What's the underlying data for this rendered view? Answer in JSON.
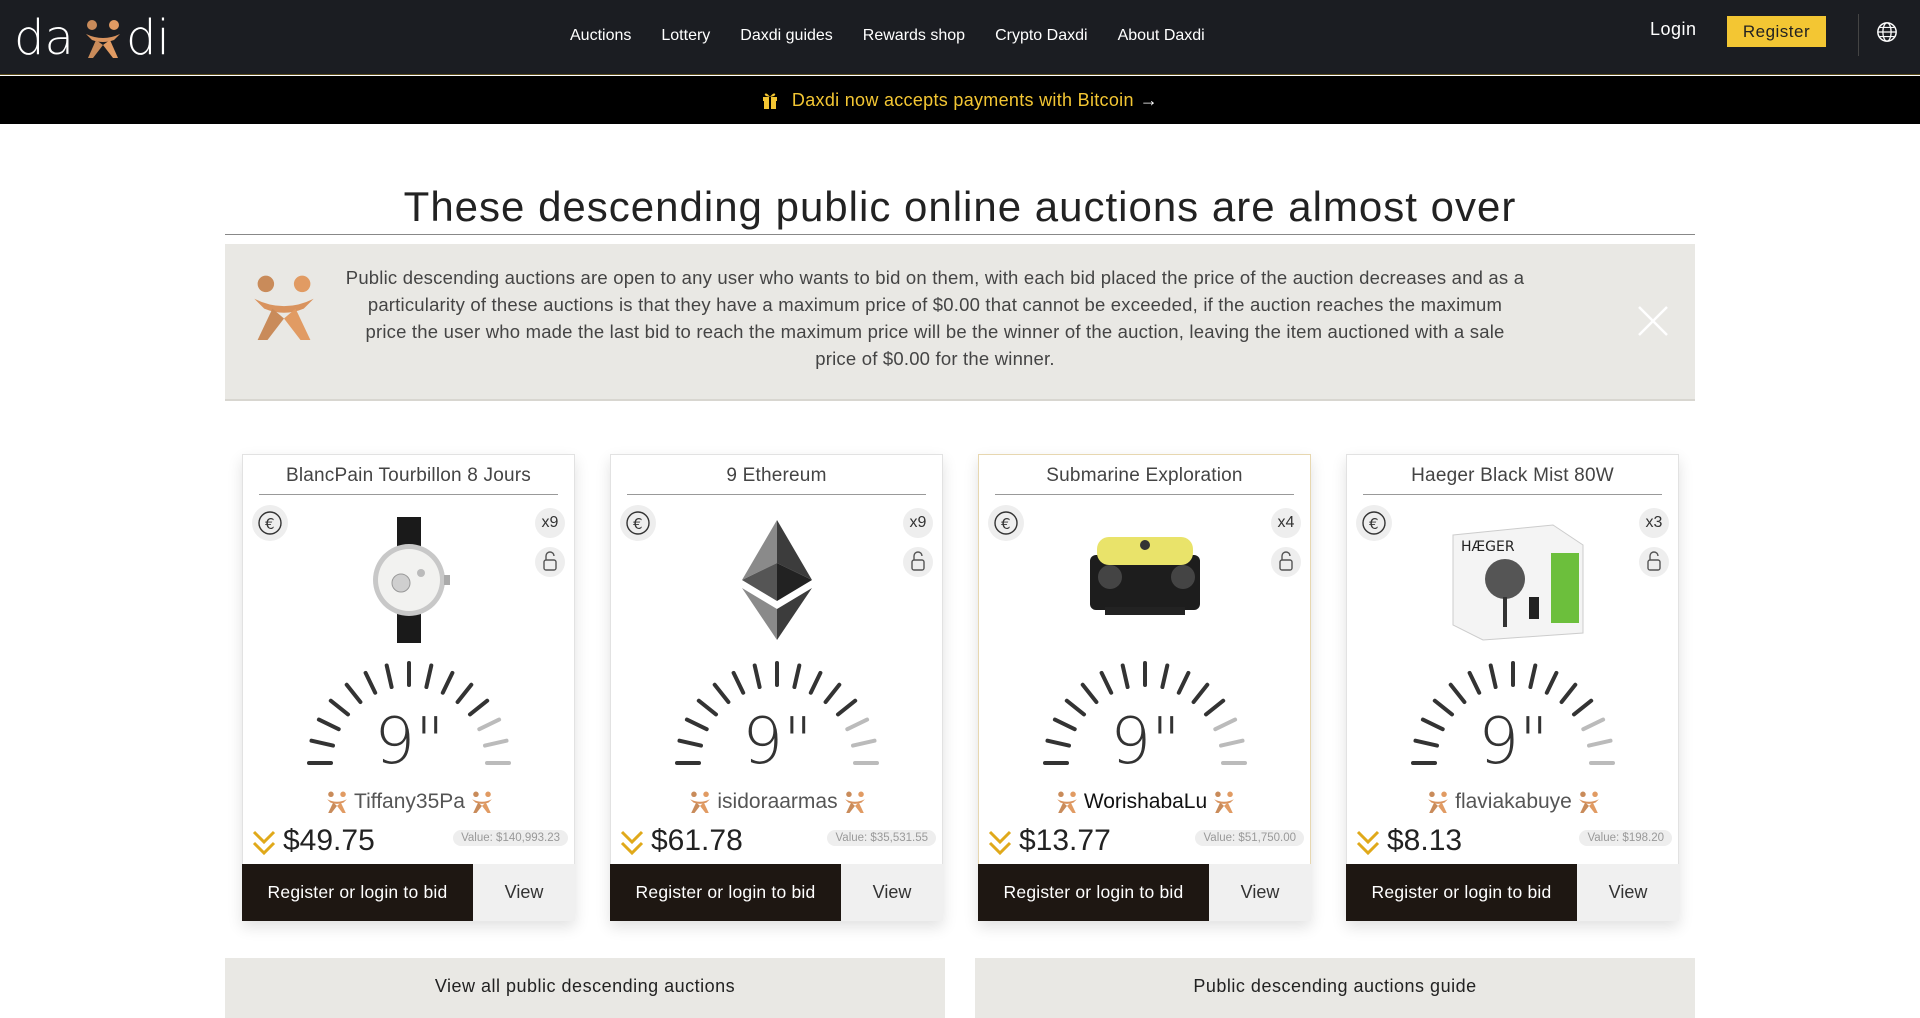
{
  "header": {
    "logo": "daxdi",
    "nav": [
      "Auctions",
      "Lottery",
      "Daxdi guides",
      "Rewards shop",
      "Crypto Daxdi",
      "About Daxdi"
    ],
    "login_label": "Login",
    "register_label": "Register",
    "globe_icon": "globe-icon"
  },
  "promo": {
    "text": "Daxdi now accepts payments with Bitcoin",
    "arrow": "→",
    "icon": "gift-icon",
    "color": "#f3c633"
  },
  "page": {
    "title": "These descending public online auctions are almost over"
  },
  "info": {
    "text": "Public descending auctions are open to any user who wants to bid on them, with each bid placed the price of the auction decreases and as a particularity of these auctions is that they have a maximum price of $0.00 that cannot be exceeded, if the auction reaches the maximum price the user who made the last bid to reach the maximum price will be the winner of the auction, leaving the item auctioned with a sale price of $0.00 for the winner."
  },
  "cards": [
    {
      "title": "BlancPain Tourbillon 8 Jours",
      "multiplier": "x9",
      "timer": "9\"",
      "bidder": "Tiffany35Pa",
      "price": "$49.75",
      "value": "Value: $140,993.23",
      "bid_label": "Register or login to bid",
      "view_label": "View",
      "image": "watch-image"
    },
    {
      "title": "9 Ethereum",
      "multiplier": "x9",
      "timer": "9\"",
      "bidder": "isidoraarmas",
      "price": "$61.78",
      "value": "Value: $35,531.55",
      "bid_label": "Register or login to bid",
      "view_label": "View",
      "image": "ethereum-image"
    },
    {
      "title": "Submarine Exploration",
      "multiplier": "x4",
      "timer": "9\"",
      "bidder": "WorishabaLu",
      "price": "$13.77",
      "value": "Value: $51,750.00",
      "bid_label": "Register or login to bid",
      "view_label": "View",
      "image": "submarine-image"
    },
    {
      "title": "Haeger Black Mist 80W",
      "multiplier": "x3",
      "timer": "9\"",
      "bidder": "flaviakabuye",
      "price": "$8.13",
      "value": "Value: $198.20",
      "bid_label": "Register or login to bid",
      "view_label": "View",
      "image": "fan-image"
    }
  ],
  "bottom": {
    "all_label": "View all public descending auctions",
    "guide_label": "Public descending auctions guide"
  },
  "colors": {
    "accent": "#f3c633",
    "brand": "#e19b63",
    "dark": "#1b1d22"
  }
}
